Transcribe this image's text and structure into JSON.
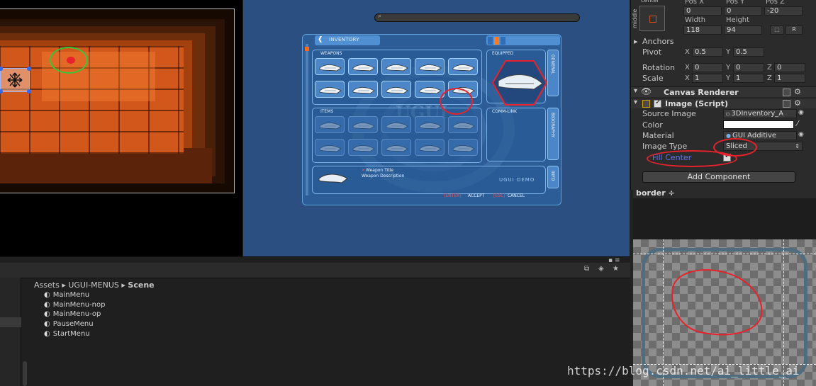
{
  "inventory": {
    "title": "INVENTORY",
    "weapons_label": "WEAPONS",
    "equipped_label": "EQUIPPED",
    "items_label": "ITEMS",
    "comm_label": "COMM-LINK",
    "tabs": [
      "GENERAL",
      "BIOGRAPHY",
      "INFO"
    ],
    "logo_text": "UGUI",
    "weapon_title": "Weapon Title",
    "weapon_description": "Weapon Description",
    "demo_label": "UGUI DEMO",
    "enter_key": "[ENTER]",
    "accept_label": "ACCEPT",
    "esc_key": "[ESC]",
    "cancel_label": "CANCEL"
  },
  "inspector": {
    "center_label": "center",
    "middle_label": "middle",
    "pos_x_label": "Pos X",
    "pos_y_label": "Pos Y",
    "pos_z_label": "Pos Z",
    "pos_x": "0",
    "pos_y": "0",
    "pos_z": "-20",
    "width_label": "Width",
    "height_label": "Height",
    "width": "118",
    "height": "94",
    "r_button": "R",
    "anchors_label": "Anchors",
    "pivot_label": "Pivot",
    "pivot_x": "0.5",
    "pivot_y": "0.5",
    "rotation_label": "Rotation",
    "rot_x": "0",
    "rot_y": "0",
    "rot_z": "0",
    "scale_label": "Scale",
    "scale_x": "1",
    "scale_y": "1",
    "scale_z": "1",
    "canvas_renderer": "Canvas Renderer",
    "image_script": "Image (Script)",
    "source_image_label": "Source Image",
    "source_image": "3DInventory_A",
    "color_label": "Color",
    "material_label": "Material",
    "material": "GUI Additive",
    "image_type_label": "Image Type",
    "image_type": "Sliced",
    "fill_center_label": "Fill Center",
    "add_component": "Add Component",
    "x": "X",
    "y": "Y",
    "z": "Z"
  },
  "project": {
    "breadcrumb": [
      "Assets",
      "UGUI-MENUS",
      "Scene"
    ],
    "scenes": [
      "MainMenu",
      "MainMenu-nop",
      "MainMenu-op",
      "PauseMenu",
      "StartMenu"
    ]
  },
  "preview": {
    "label": "border",
    "arrows": "÷"
  },
  "watermark": "https://blog.csdn.net/ai_little_ai"
}
